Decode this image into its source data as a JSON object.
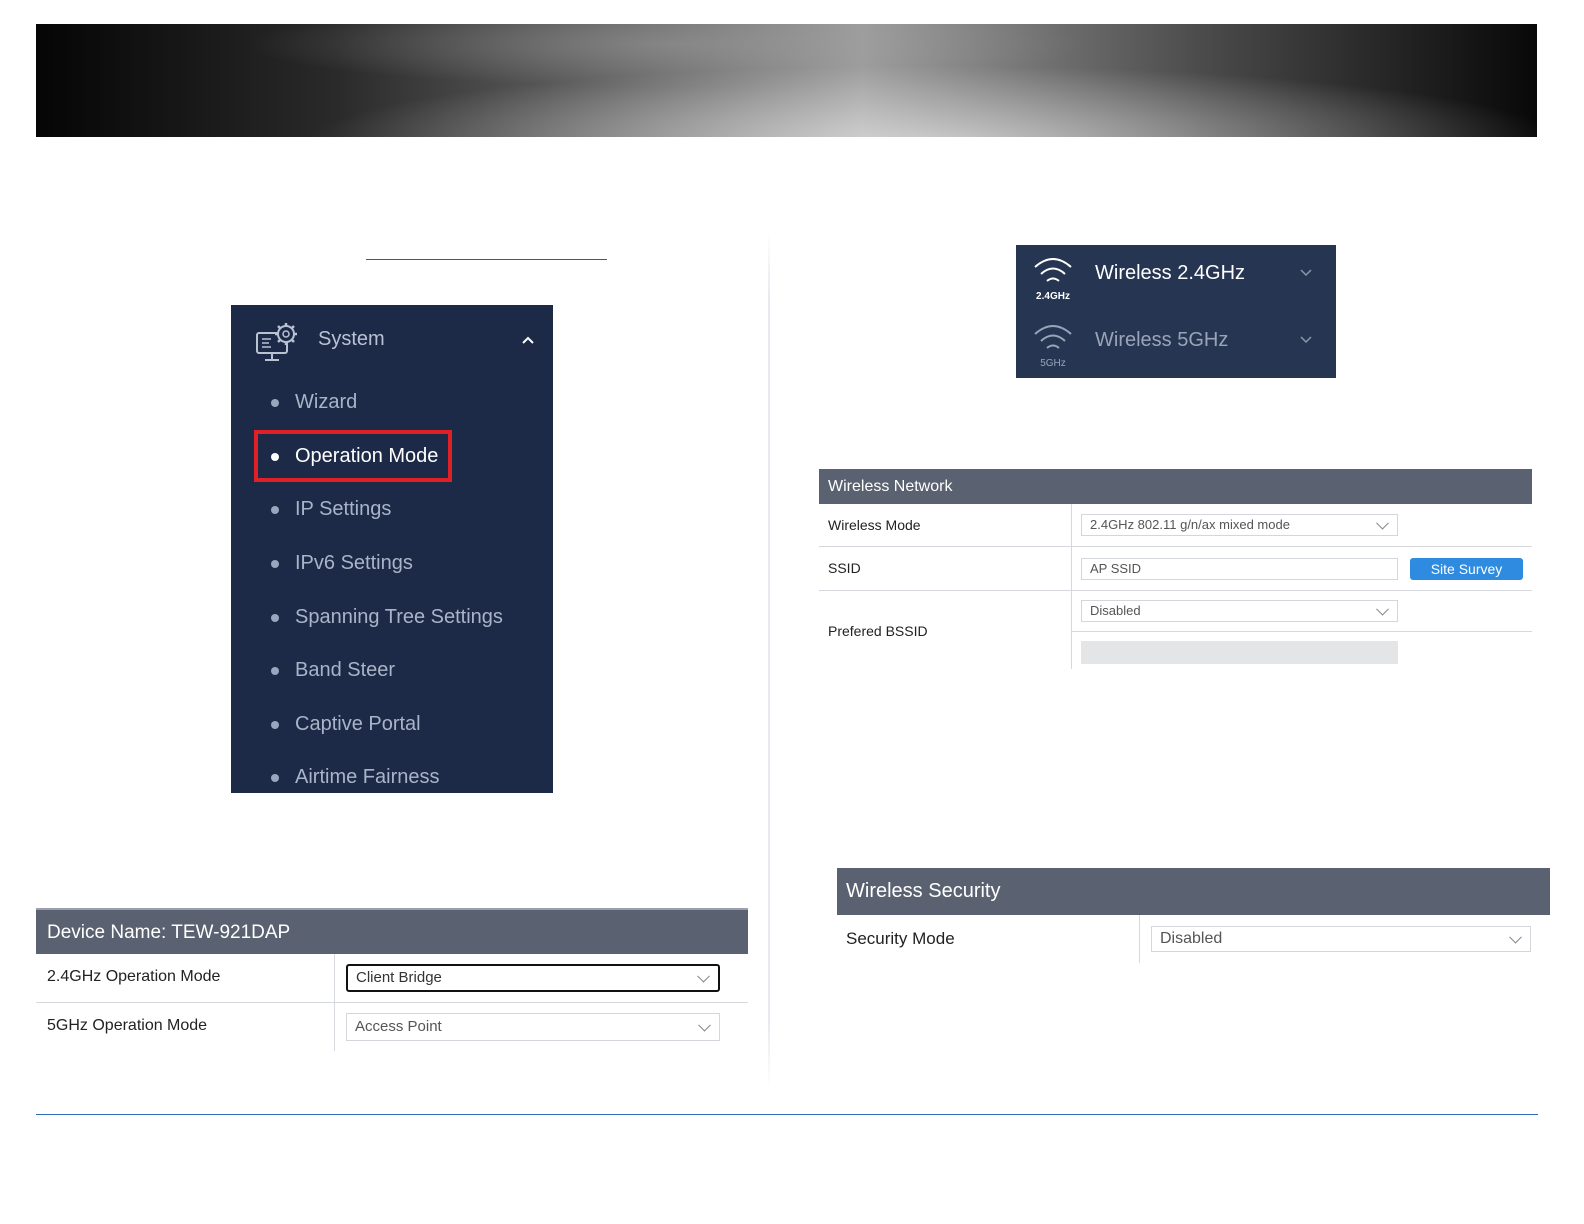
{
  "sidebar": {
    "title": "System",
    "items": [
      {
        "label": "Wizard"
      },
      {
        "label": "Operation Mode"
      },
      {
        "label": "IP Settings"
      },
      {
        "label": "IPv6 Settings"
      },
      {
        "label": "Spanning Tree Settings"
      },
      {
        "label": "Band Steer"
      },
      {
        "label": "Captive Portal"
      },
      {
        "label": "Airtime Fairness"
      }
    ],
    "active_index": 1
  },
  "device": {
    "header": "Device Name: TEW-921DAP",
    "rows": [
      {
        "label": "2.4GHz Operation Mode",
        "value": "Client Bridge"
      },
      {
        "label": "5GHz Operation Mode",
        "value": "Access Point"
      }
    ]
  },
  "bands": {
    "items": [
      {
        "label": "Wireless 2.4GHz",
        "icon_text": "2.4GHz",
        "icon": "wifi-icon"
      },
      {
        "label": "Wireless 5GHz",
        "icon_text": "5GHz",
        "icon": "wifi-icon"
      }
    ]
  },
  "wireless_network": {
    "header": "Wireless Network",
    "mode_label": "Wireless Mode",
    "mode_value": "2.4GHz 802.11 g/n/ax mixed mode",
    "ssid_label": "SSID",
    "ssid_value": "AP SSID",
    "site_survey_label": "Site Survey",
    "bssid_label": "Prefered BSSID",
    "bssid_value": "Disabled"
  },
  "wireless_security": {
    "header": "Wireless Security",
    "mode_label": "Security Mode",
    "mode_value": "Disabled"
  },
  "colors": {
    "sidebar_bg": "#1c2a47",
    "table_header_bg": "#5a6170",
    "highlight": "#e02027",
    "button": "#2f8be0"
  }
}
